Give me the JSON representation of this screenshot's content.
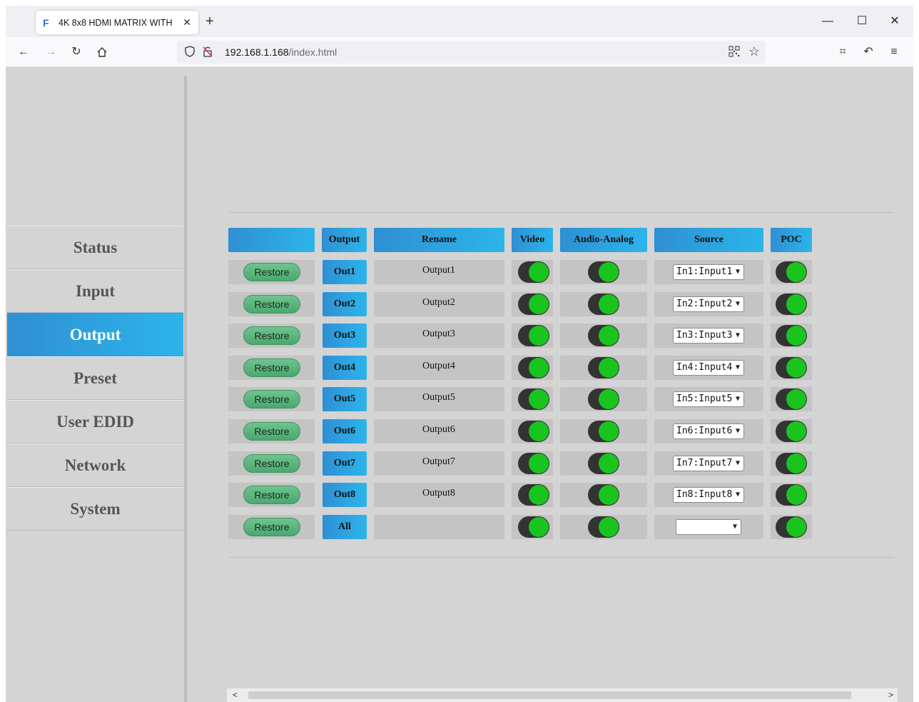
{
  "browser": {
    "tab_title": "4K 8x8 HDMI MATRIX WITH",
    "tab_favicon": "F",
    "url_host": "192.168.1.168",
    "url_path": "/index.html"
  },
  "sidebar": {
    "items": [
      {
        "label": "Status"
      },
      {
        "label": "Input"
      },
      {
        "label": "Output"
      },
      {
        "label": "Preset"
      },
      {
        "label": "User EDID"
      },
      {
        "label": "Network"
      },
      {
        "label": "System"
      }
    ],
    "active": "Output"
  },
  "table": {
    "headers": [
      "",
      "Output",
      "Rename",
      "Video",
      "Audio-Analog",
      "Source",
      "POC"
    ],
    "restore_label": "Restore",
    "rows": [
      {
        "out": "Out1",
        "rename": "Output1",
        "source": "In1:Input1",
        "video": true,
        "audio": true,
        "poc": true
      },
      {
        "out": "Out2",
        "rename": "Output2",
        "source": "In2:Input2",
        "video": true,
        "audio": true,
        "poc": true
      },
      {
        "out": "Out3",
        "rename": "Output3",
        "source": "In3:Input3",
        "video": true,
        "audio": true,
        "poc": true
      },
      {
        "out": "Out4",
        "rename": "Output4",
        "source": "In4:Input4",
        "video": true,
        "audio": true,
        "poc": true
      },
      {
        "out": "Out5",
        "rename": "Output5",
        "source": "In5:Input5",
        "video": true,
        "audio": true,
        "poc": true
      },
      {
        "out": "Out6",
        "rename": "Output6",
        "source": "In6:Input6",
        "video": true,
        "audio": true,
        "poc": true
      },
      {
        "out": "Out7",
        "rename": "Output7",
        "source": "In7:Input7",
        "video": true,
        "audio": true,
        "poc": true
      },
      {
        "out": "Out8",
        "rename": "Output8",
        "source": "In8:Input8",
        "video": true,
        "audio": true,
        "poc": true
      },
      {
        "out": "All",
        "rename": "",
        "source": "",
        "video": true,
        "audio": true,
        "poc": true
      }
    ]
  },
  "colors": {
    "accent_gradient_start": "#2f8fd3",
    "accent_gradient_end": "#2cb5ea",
    "toggle_on": "#19c41f",
    "restore_green": "#5bb87d",
    "page_bg": "#d4d4d4"
  }
}
